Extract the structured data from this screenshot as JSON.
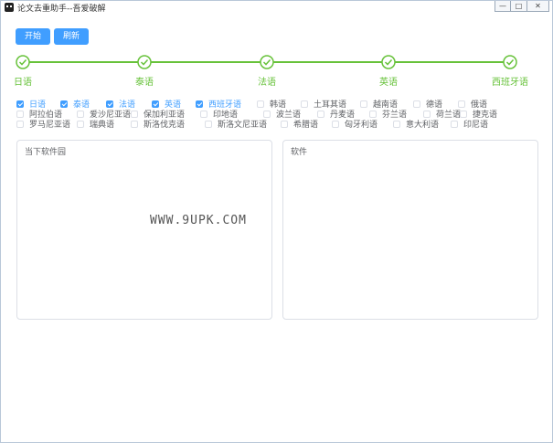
{
  "window": {
    "title": "论文去重助手--吾爱破解",
    "minimize_glyph": "—",
    "maximize_glyph": "□",
    "close_glyph": "✕"
  },
  "toolbar": {
    "start_label": "开始",
    "refresh_label": "刷新"
  },
  "steps": [
    {
      "label": "日语",
      "status": "done"
    },
    {
      "label": "泰语",
      "status": "done"
    },
    {
      "label": "法语",
      "status": "done"
    },
    {
      "label": "英语",
      "status": "done"
    },
    {
      "label": "西班牙语",
      "status": "done"
    }
  ],
  "languages": [
    [
      {
        "label": "日语",
        "checked": true
      },
      {
        "label": "泰语",
        "checked": true
      },
      {
        "label": "法语",
        "checked": true
      },
      {
        "label": "英语",
        "checked": true
      },
      {
        "label": "西班牙语",
        "checked": true
      },
      {
        "label": "韩语",
        "checked": false
      },
      {
        "label": "土耳其语",
        "checked": false
      },
      {
        "label": "越南语",
        "checked": false
      },
      {
        "label": "德语",
        "checked": false
      },
      {
        "label": "俄语",
        "checked": false
      }
    ],
    [
      {
        "label": "阿拉伯语",
        "checked": false
      },
      {
        "label": "爱沙尼亚语",
        "checked": false
      },
      {
        "label": "保加利亚语",
        "checked": false
      },
      {
        "label": "印地语",
        "checked": false
      },
      {
        "label": "波兰语",
        "checked": false
      },
      {
        "label": "丹麦语",
        "checked": false
      },
      {
        "label": "芬兰语",
        "checked": false
      },
      {
        "label": "荷兰语",
        "checked": false
      },
      {
        "label": "捷克语",
        "checked": false
      }
    ],
    [
      {
        "label": "罗马尼亚语",
        "checked": false
      },
      {
        "label": "瑞典语",
        "checked": false
      },
      {
        "label": "斯洛伐克语",
        "checked": false
      },
      {
        "label": "斯洛文尼亚语",
        "checked": false
      },
      {
        "label": "希腊语",
        "checked": false
      },
      {
        "label": "匈牙利语",
        "checked": false
      },
      {
        "label": "意大利语",
        "checked": false
      },
      {
        "label": "印尼语",
        "checked": false
      }
    ]
  ],
  "panels": {
    "left_title": "当下软件园",
    "right_title": "软件"
  },
  "watermark": "WWW.9UPK.COM",
  "colors": {
    "primary": "#409eff",
    "success": "#67c23a",
    "border": "#dcdfe6",
    "text": "#606266"
  }
}
